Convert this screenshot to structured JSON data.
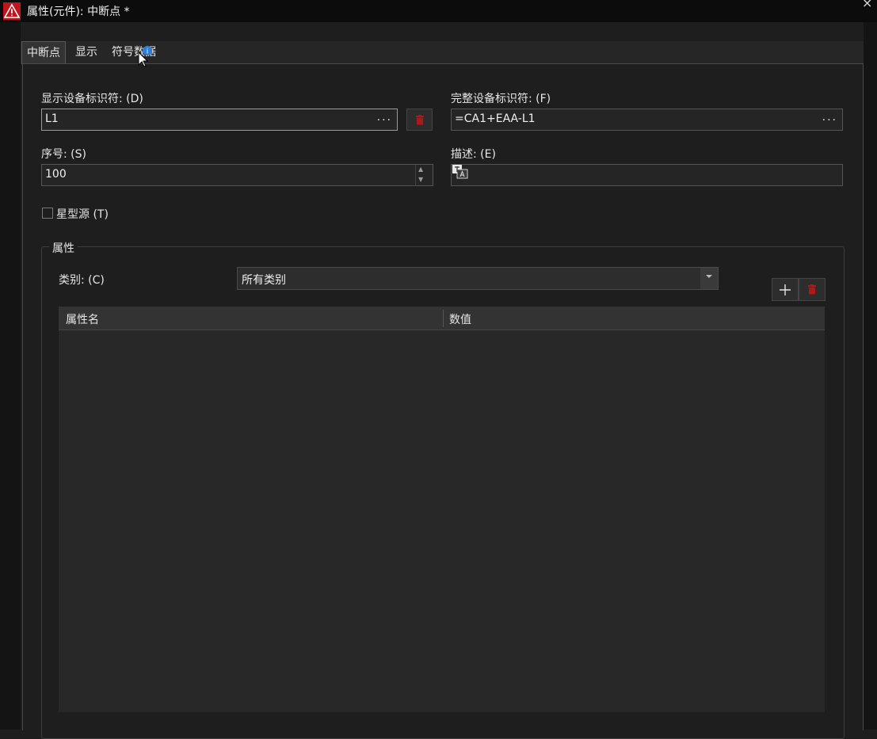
{
  "window": {
    "title": "属性(元件): 中断点 *",
    "close": "×"
  },
  "tabs": [
    {
      "label": "中断点",
      "active": true
    },
    {
      "label": "显示",
      "active": false
    },
    {
      "label": "符号数据",
      "active": false
    }
  ],
  "fields": {
    "display_id_label": "显示设备标识符: (D)",
    "display_id_value": "L1",
    "full_id_label": "完整设备标识符: (F)",
    "full_id_value": "=CA1+EAA-L1",
    "sequence_label": "序号: (S)",
    "sequence_value": "100",
    "description_label": "描述: (E)",
    "description_value": "",
    "ellipsis": "..."
  },
  "star_source": {
    "label": "星型源 (T)",
    "checked": false
  },
  "properties": {
    "group_title": "属性",
    "category_label": "类别: (C)",
    "category_value": "所有类别",
    "columns": [
      "属性名",
      "数值"
    ],
    "rows": []
  },
  "icons": {
    "app": "warning-triangle-icon",
    "delete": "trash-icon",
    "add": "plus-icon",
    "translate": "translate-icon",
    "cursor": "mouse-pointer-icon"
  },
  "colors": {
    "accent_red": "#c0141e",
    "background": "#1e1e1e"
  }
}
